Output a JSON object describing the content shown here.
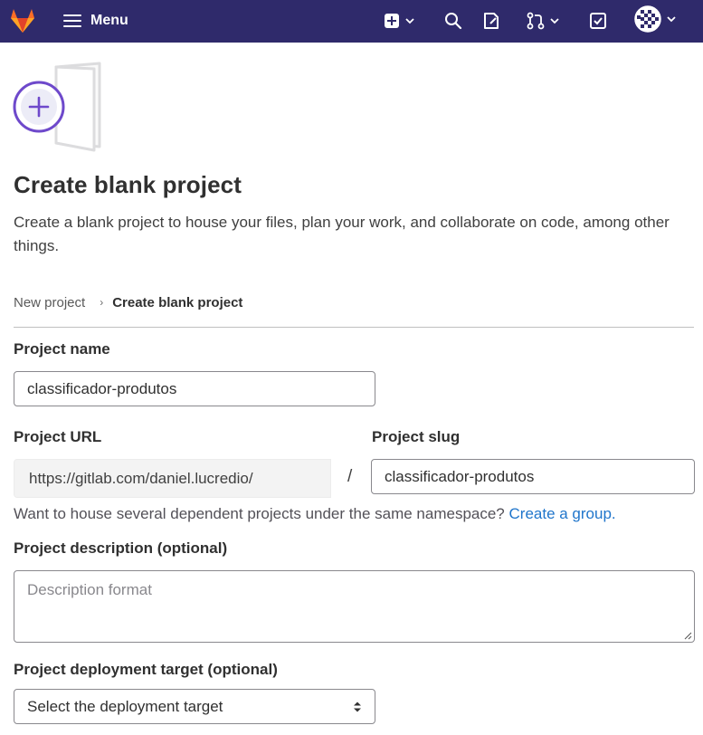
{
  "navbar": {
    "menu_label": "Menu",
    "bg_color": "#2f2a6b",
    "icons": [
      "gitlab-logo",
      "hamburger-icon",
      "plus-square-icon",
      "search-icon",
      "issues-icon",
      "merge-request-icon",
      "todo-icon",
      "avatar"
    ]
  },
  "header": {
    "title": "Create blank project",
    "description": "Create a blank project to house your files, plan your work, and collaborate on code, among other things."
  },
  "breadcrumb": {
    "parent": "New project",
    "current": "Create blank project"
  },
  "form": {
    "project_name": {
      "label": "Project name",
      "value": "classificador-produtos"
    },
    "project_url": {
      "label": "Project URL",
      "prefix": "https://gitlab.com/daniel.lucredio/",
      "separator": "/"
    },
    "project_slug": {
      "label": "Project slug",
      "value": "classificador-produtos"
    },
    "namespace_help": {
      "text": "Want to house several dependent projects under the same namespace?",
      "link": "Create a group."
    },
    "description": {
      "label": "Project description (optional)",
      "placeholder": "Description format"
    },
    "deployment_target": {
      "label": "Project deployment target (optional)",
      "selected": "Select the deployment target"
    }
  },
  "colors": {
    "accent": "#6e49cb",
    "link": "#1f75cb"
  }
}
